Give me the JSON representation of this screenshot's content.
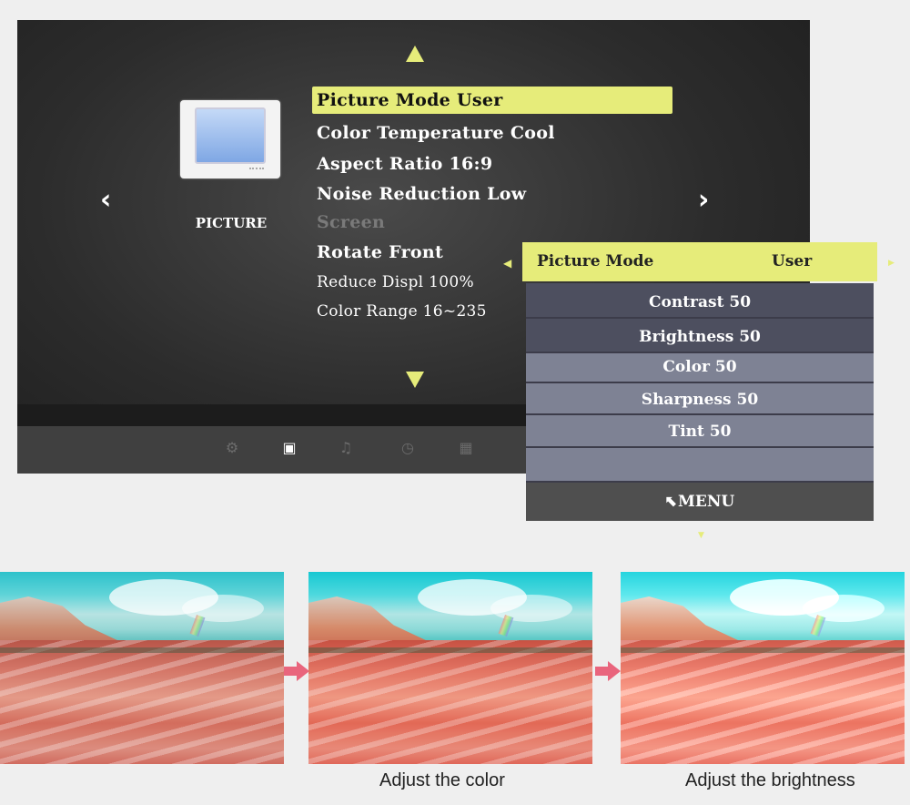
{
  "osd": {
    "category_label": "PICTURE",
    "menu_items": [
      "Picture Mode User",
      "Color Temperature Cool",
      "Aspect Ratio 16:9",
      "Noise Reduction Low",
      "Screen",
      "Rotate Front",
      "Reduce Displ 100%",
      "Color Range 16~235"
    ],
    "selected_index": 0,
    "disabled_index": 4,
    "icon_bar": [
      "gear-icon",
      "monitor-icon",
      "music-note-icon",
      "clock-icon",
      "grid-icon"
    ],
    "active_icon": "monitor-icon",
    "accent_color": "#e6ec7a"
  },
  "submenu": {
    "header_key": "Picture Mode",
    "header_value": "User",
    "rows": [
      "Contrast 50",
      "Brightness 50",
      "Color 50",
      "Sharpness 50",
      "Tint 50",
      ""
    ],
    "menu_label": "MENU"
  },
  "captions": {
    "second": "Adjust the color",
    "third": "Adjust the brightness"
  },
  "colors": {
    "arrow": "#e9657d"
  }
}
